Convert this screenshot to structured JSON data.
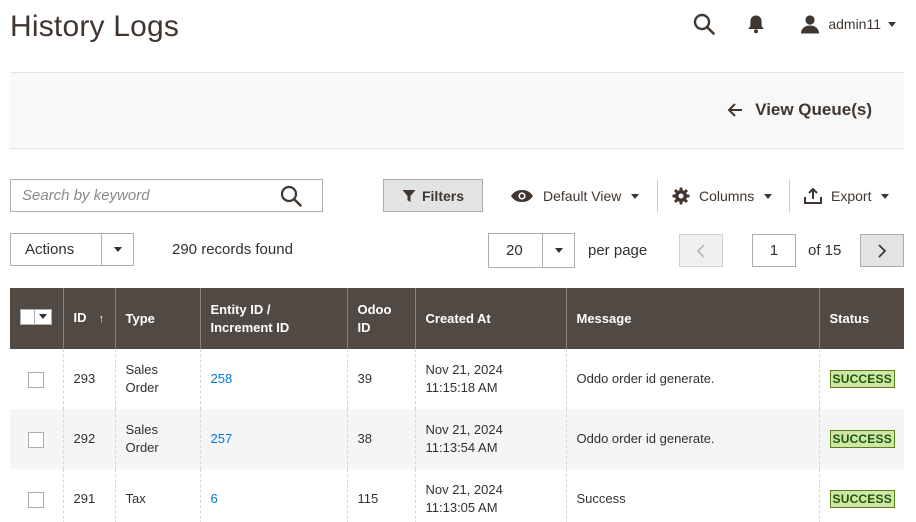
{
  "header": {
    "title": "History Logs",
    "user_name": "admin11"
  },
  "page_actions": {
    "back_label": "View Queue(s)"
  },
  "toolbar": {
    "search_placeholder": "Search by keyword",
    "filters_label": "Filters",
    "view_label": "Default View",
    "columns_label": "Columns",
    "export_label": "Export",
    "actions_label": "Actions",
    "records_found": "290 records found",
    "per_page_value": "20",
    "per_page_label": "per page",
    "current_page": "1",
    "page_of": "of 15"
  },
  "table": {
    "columns": {
      "id": "ID",
      "id_sort": "↑",
      "type": "Type",
      "entity_line1": "Entity ID /",
      "entity_line2": "Increment ID",
      "odoo_line1": "Odoo",
      "odoo_line2": "ID",
      "created_at": "Created At",
      "message": "Message",
      "status": "Status"
    },
    "rows": [
      {
        "id": "293",
        "type_line1": "Sales",
        "type_line2": "Order",
        "entity_id": "258",
        "odoo_id": "39",
        "date": "Nov 21, 2024",
        "time": "11:15:18 AM",
        "message": "Oddo order id generate.",
        "status": "SUCCESS"
      },
      {
        "id": "292",
        "type_line1": "Sales",
        "type_line2": "Order",
        "entity_id": "257",
        "odoo_id": "38",
        "date": "Nov 21, 2024",
        "time": "11:13:54 AM",
        "message": "Oddo order id generate.",
        "status": "SUCCESS"
      },
      {
        "id": "291",
        "type_line1": "Tax",
        "type_line2": "",
        "entity_id": "6",
        "odoo_id": "115",
        "date": "Nov 21, 2024",
        "time": "11:13:05 AM",
        "message": "Success",
        "status": "SUCCESS"
      }
    ]
  },
  "colors": {
    "header_bg": "#514943",
    "link": "#007bdb",
    "success_bg": "#d0e5a9",
    "success_text": "#185b00"
  }
}
